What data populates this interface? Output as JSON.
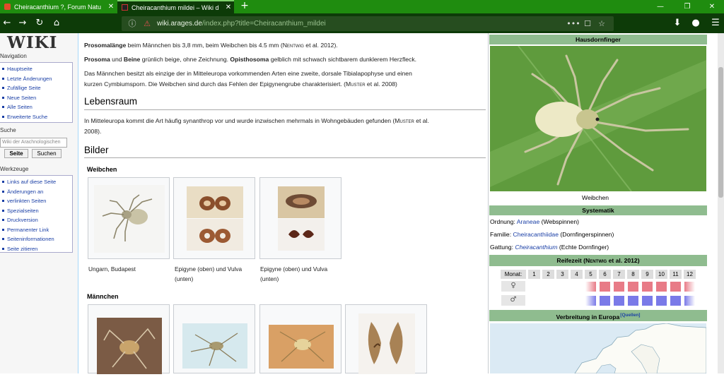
{
  "browser": {
    "tabs": [
      {
        "title": "Cheiracanthium ?, Forum Natu",
        "close": "✕"
      },
      {
        "title": "Cheiracanthium mildei – Wiki d",
        "close": "✕"
      }
    ],
    "new_tab": "+",
    "window_controls": [
      "—",
      "❐",
      "✕"
    ],
    "nav_buttons": [
      "←",
      "→",
      "↻",
      "⌂"
    ],
    "url_domain": "wiki.arages.de",
    "url_path": "/index.php?title=Cheiracanthium_mildei",
    "url_icons": [
      "ⓘ",
      "⚠"
    ],
    "page_actions": [
      "•••",
      "☐",
      "☆"
    ],
    "toolbar_icons": [
      "⬇",
      "●",
      "☰"
    ]
  },
  "sidebar": {
    "logo": "WIKI",
    "navigation_heading": "Navigation",
    "navigation_items": [
      "Hauptseite",
      "Letzte Änderungen",
      "Zufällige Seite",
      "Neue Seiten",
      "Alle Seiten",
      "Erweiterte Suche"
    ],
    "search_heading": "Suche",
    "search_placeholder": "Wiki der Arachnologischen",
    "search_go": "Seite",
    "search_button": "Suchen",
    "tools_heading": "Werkzeuge",
    "tools_items": [
      "Links auf diese Seite",
      "Änderungen an",
      "verlinkten Seiten",
      "Spezialseiten",
      "Druckversion",
      "Permanenter Link",
      "Seiteninformationen",
      "Seite zitieren"
    ]
  },
  "article": {
    "p1_bold": "Prosomalänge",
    "p1_text": " beim Männchen bis 3,8 mm, beim Weibchen bis 4.5 mm (",
    "p1_cite": "Nentwig",
    "p1_end": " et al. 2012).",
    "p2_bold1": "Prosoma",
    "p2_text1": " und ",
    "p2_bold2": "Beine",
    "p2_text2": " grünlich beige, ohne Zeichnung. ",
    "p2_bold3": "Opisthosoma",
    "p2_text3": " gelblich mit schwach sichtbarem dunklerem Herzfleck.",
    "p3_line1": "Das Männchen besitzt als einzige der in Mitteleuropa vorkommenden Arten eine zweite, dorsale Tibialapophyse und einen",
    "p3_line2a": "kurzen Cymbiumsporn. Die Weibchen sind durch das Fehlen der Epigynengrube charakterisiert. (",
    "p3_cite": "Muster",
    "p3_end": " et al. 2008)",
    "h_lebensraum": "Lebensraum",
    "p4_line1a": "In Mitteleuropa kommt die Art häufig synanthrop vor und wurde inzwischen mehrmals in Wohngebäuden gefunden (",
    "p4_cite": "Muster",
    "p4_line1b": " et al.",
    "p4_line2": "2008).",
    "h_bilder": "Bilder",
    "h_weibchen": "Weibchen",
    "captions_weibchen": [
      "Ungarn, Budapest",
      "Epigyne (oben) und Vulva",
      "(unten)",
      "Epigyne (oben) und Vulva",
      "(unten)"
    ],
    "h_maennchen": "Männchen"
  },
  "infobox": {
    "title": "Hausdornfinger",
    "photo_caption": "Weibchen",
    "systematik": "Systematik",
    "ordnung_label": "Ordnung: ",
    "ordnung_link": "Araneae",
    "ordnung_rest": " (Webspinnen)",
    "familie_label": "Familie: ",
    "familie_link": "Cheiracanthiidae",
    "familie_rest": " (Dornfingerspinnen)",
    "gattung_label": "Gattung: ",
    "gattung_link": "Cheiracanthium",
    "gattung_rest": " (Echte Dornfinger)",
    "reifezeit_a": "Reifezeit (",
    "reifezeit_cite": "Nentwig",
    "reifezeit_b": " et al. 2012)",
    "monat_label": "Monat:",
    "months": [
      "1",
      "2",
      "3",
      "4",
      "5",
      "6",
      "7",
      "8",
      "9",
      "10",
      "11",
      "12"
    ],
    "female_symbol": "♀",
    "male_symbol": "♂",
    "female_months_mature": [
      6,
      7,
      8,
      9,
      10,
      11
    ],
    "female_months_light": [
      5,
      12
    ],
    "male_months_mature": [
      6,
      7,
      8,
      9,
      10,
      11
    ],
    "male_months_light": [
      5,
      12
    ],
    "female_color": "#e87b87",
    "male_color": "#7a7ae8",
    "verbreitung": "Verbreitung in Europa",
    "quellen": "[Quellen]"
  }
}
